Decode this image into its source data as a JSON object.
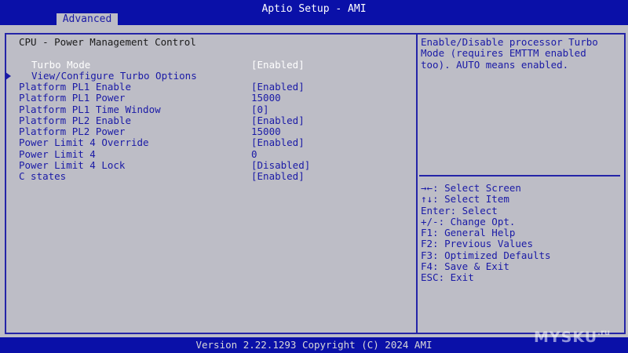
{
  "app": {
    "title": "Aptio Setup - AMI"
  },
  "tabs": [
    {
      "label": "Advanced",
      "active": true
    }
  ],
  "main": {
    "section_title": "CPU - Power Management Control",
    "items": [
      {
        "label": "Turbo Mode",
        "value": "[Enabled]",
        "selected": true
      },
      {
        "label": "View/Configure Turbo Options",
        "value": "",
        "submenu": true
      },
      {
        "label": "Platform PL1 Enable",
        "value": "[Enabled]"
      },
      {
        "label": "Platform PL1 Power",
        "value": "15000"
      },
      {
        "label": "Platform PL1 Time Window",
        "value": "[0]"
      },
      {
        "label": "Platform PL2 Enable",
        "value": "[Enabled]"
      },
      {
        "label": "Platform PL2 Power",
        "value": "15000"
      },
      {
        "label": "Power Limit 4 Override",
        "value": "[Enabled]"
      },
      {
        "label": "Power Limit 4",
        "value": "0"
      },
      {
        "label": "Power Limit 4 Lock",
        "value": "[Disabled]"
      },
      {
        "label": "C states",
        "value": "[Enabled]"
      }
    ]
  },
  "help": {
    "text": "Enable/Disable processor Turbo\nMode (requires EMTTM enabled\ntoo). AUTO means enabled.",
    "keys": [
      "→←: Select Screen",
      "↑↓: Select Item",
      "Enter: Select",
      "+/-: Change Opt.",
      "F1: General Help",
      "F2: Previous Values",
      "F3: Optimized Defaults",
      "F4: Save & Exit",
      "ESC: Exit"
    ]
  },
  "footer": {
    "text": "Version 2.22.1293 Copyright (C) 2024 AMI"
  },
  "watermark": {
    "text": "MYSKU",
    "suffix": ".ru"
  },
  "colors": {
    "background": "#bdbdc6",
    "bar": "#0a10a8",
    "text_blue": "#1a1aa6",
    "selected_text": "#ffffff"
  }
}
